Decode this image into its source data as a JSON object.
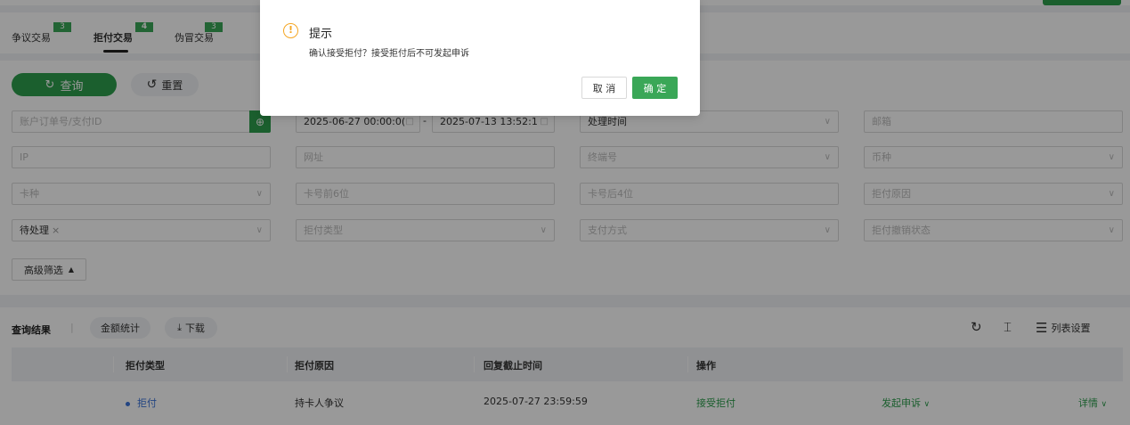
{
  "tabs": [
    {
      "label": "争议交易",
      "badge": "3"
    },
    {
      "label": "拒付交易",
      "badge": "4"
    },
    {
      "label": "伪冒交易",
      "badge": "3"
    }
  ],
  "buttons": {
    "query": "查询",
    "reset": "重置",
    "advanced": "高级筛选"
  },
  "filters": {
    "order_id_placeholder": "账户订单号/支付ID",
    "date_start": "2025-06-27 00:00:0(",
    "date_end": "2025-07-13 13:52:1",
    "date_separator": "-",
    "time_type": "处理时间",
    "email_placeholder": "邮箱",
    "ip_placeholder": "IP",
    "url_placeholder": "网址",
    "terminal_placeholder": "终端号",
    "currency_placeholder": "币种",
    "card_type_placeholder": "卡种",
    "card_first6_placeholder": "卡号前6位",
    "card_last4_placeholder": "卡号后4位",
    "chargeback_reason_placeholder": "拒付原因",
    "status_tag": "待处理",
    "chargeback_type_placeholder": "拒付类型",
    "payment_method_placeholder": "支付方式",
    "chargeback_revoke_placeholder": "拒付撤销状态"
  },
  "results": {
    "title": "查询结果",
    "divider": "|",
    "amount_stats": "金额统计",
    "download": "下载",
    "list_settings": "列表设置"
  },
  "table": {
    "headers": [
      "拒付类型",
      "拒付原因",
      "回复截止时间",
      "操作"
    ],
    "rows": [
      {
        "type": "拒付",
        "reason": "持卡人争议",
        "deadline": "2025-07-27 23:59:59",
        "accept": "接受拒付",
        "appeal": "发起申诉",
        "detail": "详情"
      }
    ]
  },
  "dialog": {
    "title": "提示",
    "message": "确认接受拒付？接受拒付后不可发起申诉",
    "cancel": "取 消",
    "confirm": "确 定"
  },
  "colors": {
    "primary": "#2e9e4e",
    "badge": "#3aa757",
    "link": "#3b73d9",
    "warning": "#f5a623"
  }
}
